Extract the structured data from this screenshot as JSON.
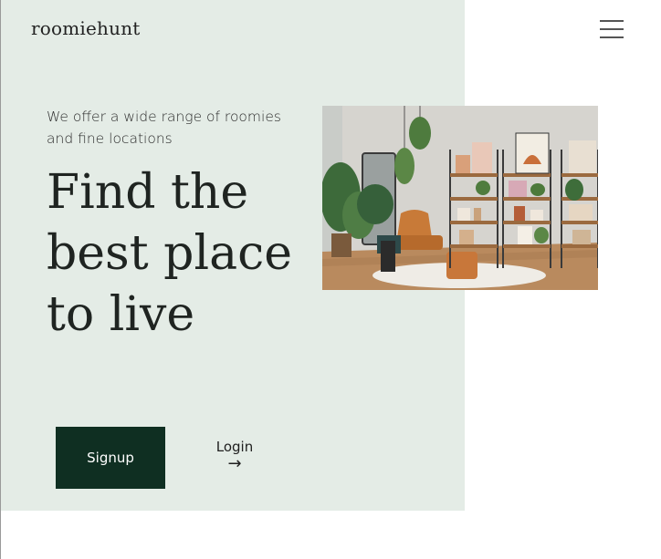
{
  "header": {
    "logo": "roomiehunt",
    "menu_icon": "hamburger-menu-icon"
  },
  "hero": {
    "tagline": "We offer a wide range of roomies and fine locations",
    "headline": "Find the best place to live",
    "signup_label": "Signup",
    "login_label": "Login",
    "login_arrow": "→",
    "panel_color": "#e4ece6",
    "accent_color": "#0f2f22"
  }
}
